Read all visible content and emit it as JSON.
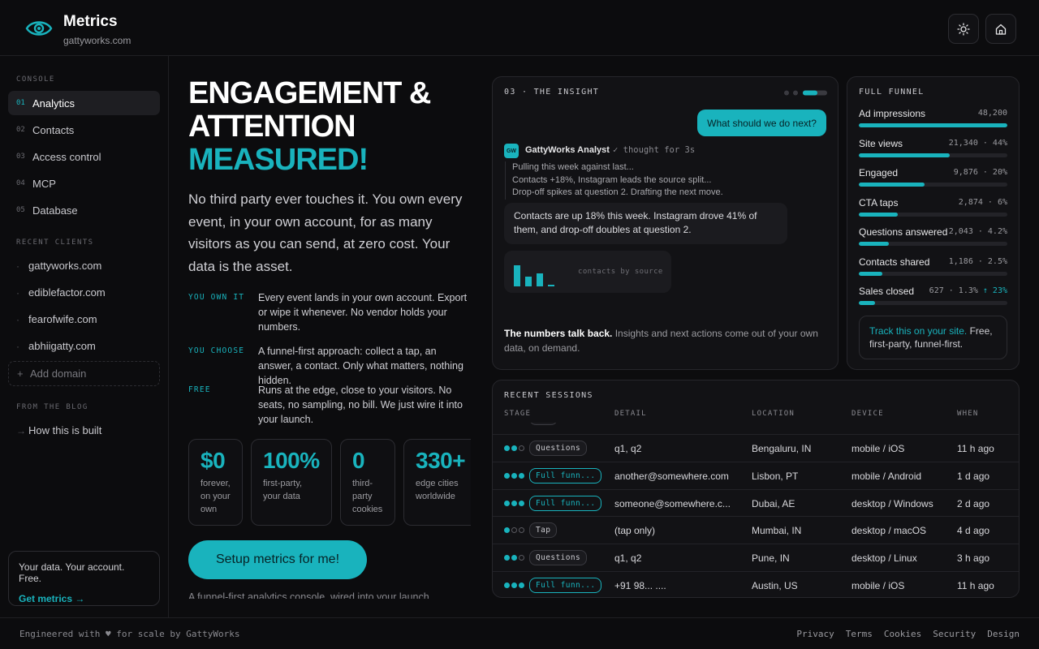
{
  "header": {
    "title": "Metrics",
    "subtitle": "gattyworks.com",
    "icons": [
      "eye-icon",
      "sun-icon",
      "home-icon"
    ]
  },
  "sidebar": {
    "console_heading": "CONSOLE",
    "nav": [
      {
        "num": "01",
        "label": "Analytics",
        "active": true
      },
      {
        "num": "02",
        "label": "Contacts"
      },
      {
        "num": "03",
        "label": "Access control"
      },
      {
        "num": "04",
        "label": "MCP"
      },
      {
        "num": "05",
        "label": "Database"
      }
    ],
    "clients_heading": "RECENT CLIENTS",
    "clients": [
      "gattyworks.com",
      "ediblefactor.com",
      "fearofwife.com",
      "abhiigatty.com"
    ],
    "add_domain": "Add domain",
    "blog_heading": "FROM THE BLOG",
    "blog_item": "How this is built",
    "card_text": "Your data. Your account. Free.",
    "card_link": "Get metrics →"
  },
  "hero": {
    "title_line1": "ENGAGEMENT &",
    "title_line2": "ATTENTION",
    "title_line3": "MEASURED!",
    "lead": "No third party ever touches it. You own every event, in your own account, for as many visitors as you can send, at zero cost. Your data is the asset.",
    "features": [
      {
        "key": "YOU OWN IT",
        "text": "Every event lands in your own account. Export or wipe it whenever. No vendor holds your numbers."
      },
      {
        "key": "YOU CHOOSE",
        "text": "A funnel-first approach: collect a tap, an answer, a contact. Only what matters, nothing hidden."
      },
      {
        "key": "FREE",
        "text": "Runs at the edge, close to your visitors. No seats, no sampling, no bill. We just wire it into your launch."
      }
    ],
    "stats": [
      {
        "value": "$0",
        "desc": "forever, on your own"
      },
      {
        "value": "100%",
        "desc": "first-party, your data"
      },
      {
        "value": "0",
        "desc": "third-party cookies"
      },
      {
        "value": "330+",
        "desc": "edge cities worldwide"
      }
    ],
    "cta": "Setup metrics for me!",
    "footnote": "A funnel-first analytics console, wired into your launch."
  },
  "insight": {
    "heading": "03 · THE INSIGHT",
    "question": "What should we do next?",
    "badge": "GW",
    "analyst": "GattyWorks Analyst",
    "analyst_meta": "✓ thought for 3s",
    "thoughts": [
      "Pulling this week against last...",
      "Contacts +18%, Instagram leads the source split...",
      "Drop-off spikes at question 2. Drafting the next move."
    ],
    "answer": "Contacts are up 18% this week. Instagram drove 41% of them, and drop-off doubles at question 2.",
    "chart_label": "contacts by source",
    "footer_bold": "The numbers talk back.",
    "footer_rest": " Insights and next actions come out of your own data, on demand."
  },
  "funnel": {
    "heading": "FULL FUNNEL",
    "rows": [
      {
        "label": "Ad impressions",
        "value": "48,200",
        "fraction": 1.0
      },
      {
        "label": "Site views",
        "value": "21,340 · 44%",
        "fraction": 0.61
      },
      {
        "label": "Engaged",
        "value": "9,876 · 20%",
        "fraction": 0.44
      },
      {
        "label": "CTA taps",
        "value": "2,874 · 6%",
        "fraction": 0.26
      },
      {
        "label": "Questions answered",
        "value": "2,043 · 4.2%",
        "fraction": 0.2
      },
      {
        "label": "Contacts shared",
        "value": "1,186 · 2.5%",
        "fraction": 0.16
      },
      {
        "label": "Sales closed",
        "value": "627 · 1.3%",
        "extra": "↑ 23%",
        "fraction": 0.11
      }
    ],
    "track_link": "Track this on your site.",
    "track_rest": " Free, first-party, funnel-first."
  },
  "sessions": {
    "heading": "RECENT SESSIONS",
    "columns": [
      "STAGE",
      "DETAIL",
      "LOCATION",
      "DEVICE",
      "WHEN"
    ],
    "rows": [
      {
        "dots": 2,
        "stage": "Questions",
        "style": "grey",
        "detail": "q1, q2",
        "location": "Bengaluru, IN",
        "device": "mobile / iOS",
        "when": "11 h ago"
      },
      {
        "dots": 3,
        "stage": "Full funn...",
        "style": "teal",
        "detail": "another@somewhere.com",
        "location": "Lisbon, PT",
        "device": "mobile / Android",
        "when": "1 d ago"
      },
      {
        "dots": 3,
        "stage": "Full funn...",
        "style": "teal",
        "detail": "someone@somewhere.c...",
        "location": "Dubai, AE",
        "device": "desktop / Windows",
        "when": "2 d ago"
      },
      {
        "dots": 1,
        "stage": "Tap",
        "style": "grey",
        "detail": "(tap only)",
        "location": "Mumbai, IN",
        "device": "desktop / macOS",
        "when": "4 d ago"
      },
      {
        "dots": 2,
        "stage": "Questions",
        "style": "grey",
        "detail": "q1, q2",
        "location": "Pune, IN",
        "device": "desktop / Linux",
        "when": "3 h ago"
      },
      {
        "dots": 3,
        "stage": "Full funn...",
        "style": "teal",
        "detail": "+91 98... ....",
        "location": "Austin, US",
        "device": "mobile / iOS",
        "when": "11 h ago"
      }
    ]
  },
  "footer": {
    "left": "Engineered with ♥ for scale by GattyWorks",
    "links": [
      "Privacy",
      "Terms",
      "Cookies",
      "Security",
      "Design"
    ]
  },
  "colors": {
    "accent": "#19b3bd",
    "background": "#0c0c0e",
    "card": "#121215"
  }
}
